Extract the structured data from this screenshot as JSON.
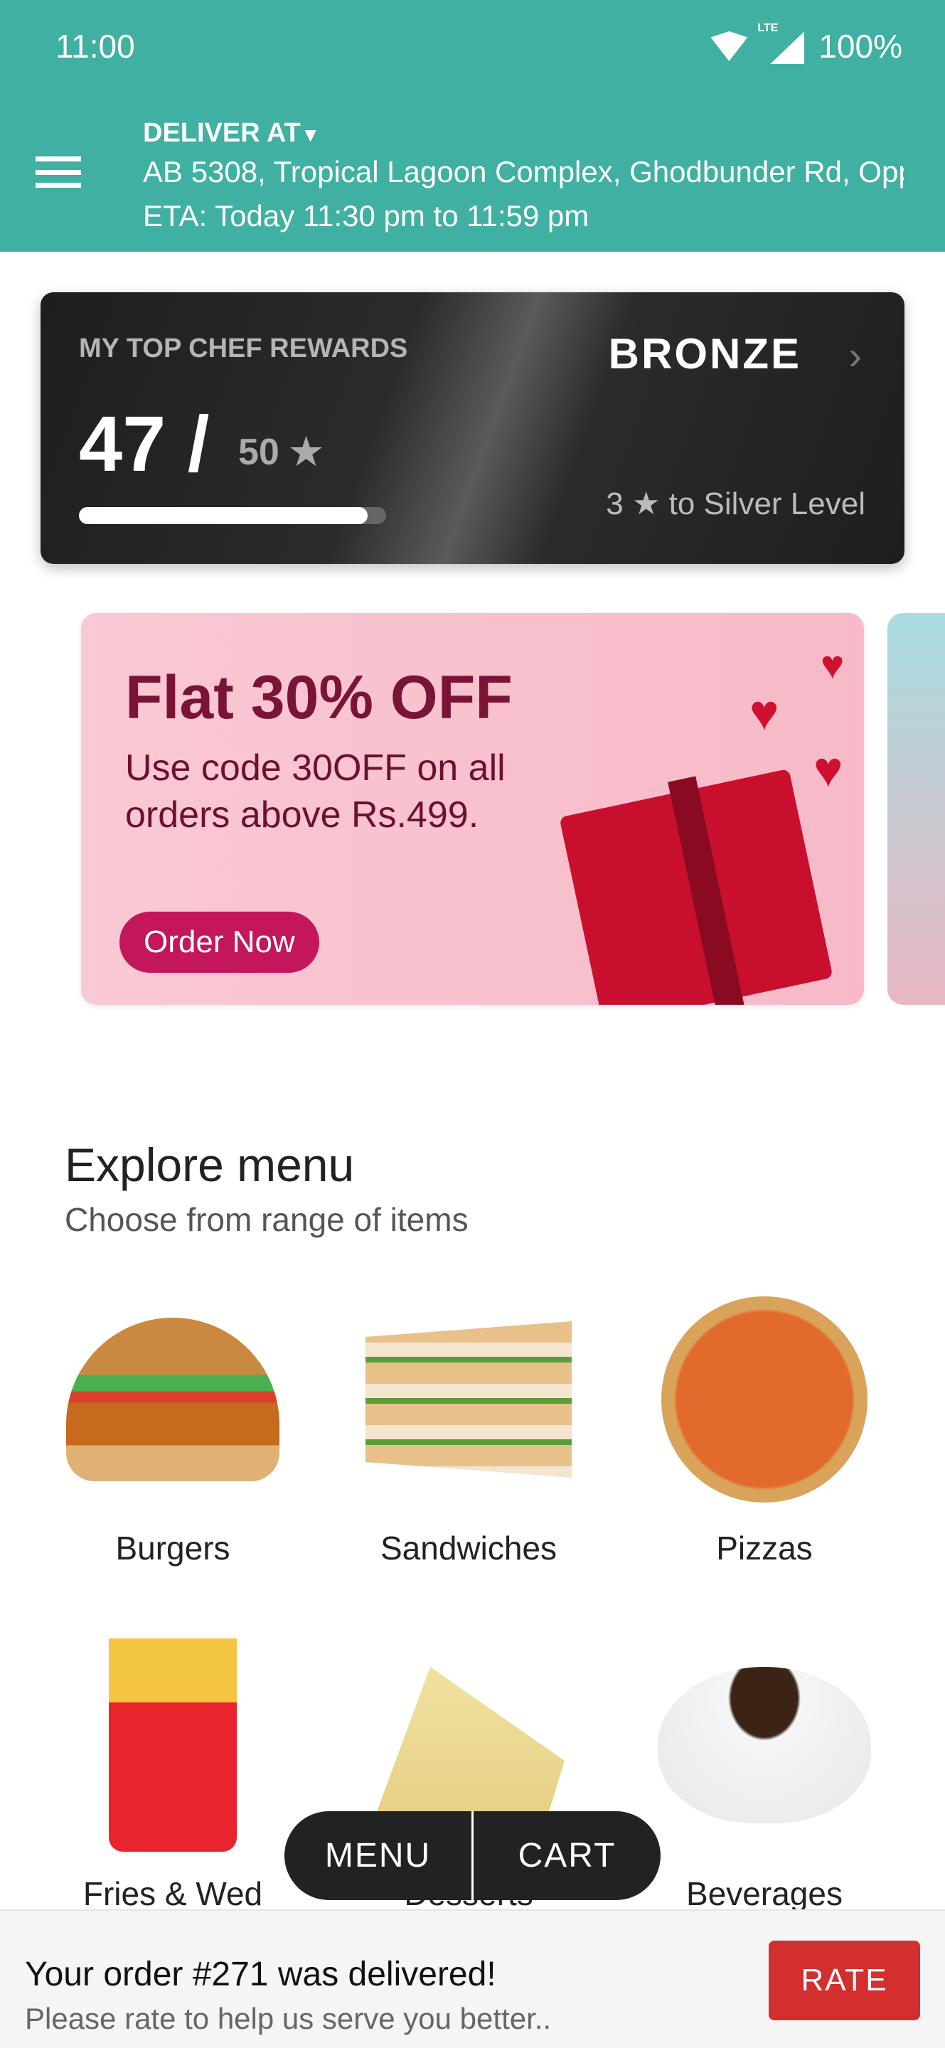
{
  "status_bar": {
    "time": "11:00",
    "network": "LTE",
    "battery": "100%"
  },
  "header": {
    "deliver_label": "DELIVER AT",
    "address": "AB 5308, Tropical Lagoon Complex, Ghodbunder Rd, Opp",
    "eta": "ETA: Today 11:30 pm to 11:59 pm"
  },
  "rewards": {
    "title": "MY TOP CHEF REWARDS",
    "tier": "BRONZE",
    "points": "47 /",
    "max": "50",
    "progress": 0.94,
    "next_count": "3",
    "next_text": "to Silver Level"
  },
  "banner": {
    "title": "Flat 30% OFF",
    "subtitle": "Use code 30OFF on all orders above Rs.499.",
    "button": "Order Now"
  },
  "explore": {
    "title": "Explore menu",
    "subtitle": "Choose from range of items",
    "items": [
      {
        "label": "Burgers"
      },
      {
        "label": "Sandwiches"
      },
      {
        "label": "Pizzas"
      },
      {
        "label": "Fries & Wed"
      },
      {
        "label": "Desserts"
      },
      {
        "label": "Beverages"
      }
    ]
  },
  "nav": {
    "menu": "MENU",
    "cart": "CART"
  },
  "order_bar": {
    "title": "Your order #271 was delivered!",
    "subtitle": "Please rate to help us serve you better..",
    "rate": "RATE"
  },
  "colors": {
    "header": "#40b0a2",
    "rate": "#d32f2f",
    "promo": "#c4165a"
  }
}
